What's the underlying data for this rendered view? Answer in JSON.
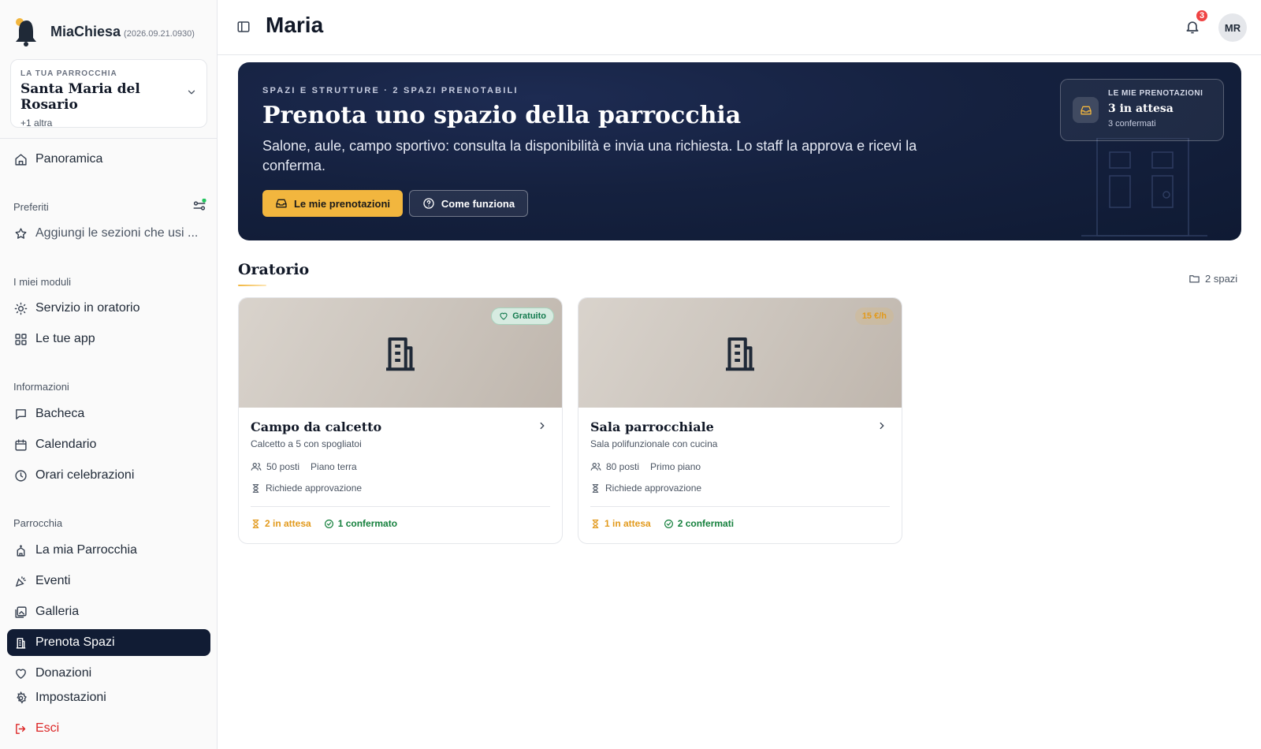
{
  "app": {
    "name": "MiaChiesa",
    "version": "(2026.09.21.0930)"
  },
  "parish": {
    "kicker": "LA TUA PARROCCHIA",
    "name": "Santa Maria del Rosario",
    "more": "+1 altra"
  },
  "sidebar": {
    "overview": "Panoramica",
    "favorites_label": "Preferiti",
    "favorites_hint": "Aggiungi le sezioni che usi ...",
    "modules_label": "I miei moduli",
    "modules": [
      "Servizio in oratorio",
      "Le tue app"
    ],
    "info_label": "Informazioni",
    "info": [
      "Bacheca",
      "Calendario",
      "Orari celebrazioni"
    ],
    "parish_label": "Parrocchia",
    "parish_items": [
      "La mia Parrocchia",
      "Eventi",
      "Galleria",
      "Prenota Spazi",
      "Donazioni"
    ],
    "settings": "Impostazioni",
    "logout": "Esci"
  },
  "topbar": {
    "title": "Maria",
    "notifications": "3",
    "avatar": "MR"
  },
  "hero": {
    "kicker": "SPAZI E STRUTTURE · 2 SPAZI PRENOTABILI",
    "title": "Prenota uno spazio della parrocchia",
    "description": "Salone, aule, campo sportivo: consulta la disponibilità e invia una richiesta. Lo staff la approva e ricevi la conferma.",
    "primary_button": "Le mie prenotazioni",
    "secondary_button": "Come funziona",
    "card": {
      "kicker": "LE MIE PRENOTAZIONI",
      "main": "3 in attesa",
      "sub": "3 confermati"
    }
  },
  "section": {
    "title": "Oratorio",
    "count": "2 spazi"
  },
  "spaces": [
    {
      "tag": "Gratuito",
      "title": "Campo da calcetto",
      "subtitle": "Calcetto a 5 con spogliatoi",
      "seats": "50 posti",
      "floor": "Piano terra",
      "approval": "Richiede approvazione",
      "pending": "2 in attesa",
      "confirmed": "1 confermato"
    },
    {
      "tag": "15 €/h",
      "title": "Sala parrocchiale",
      "subtitle": "Sala polifunzionale con cucina",
      "seats": "80 posti",
      "floor": "Primo piano",
      "approval": "Richiede approvazione",
      "pending": "1 in attesa",
      "confirmed": "2 confermati"
    }
  ],
  "colors": {
    "accent": "#f2b63e",
    "navy": "#111c34",
    "success": "#15803d",
    "danger": "#dc2626"
  }
}
